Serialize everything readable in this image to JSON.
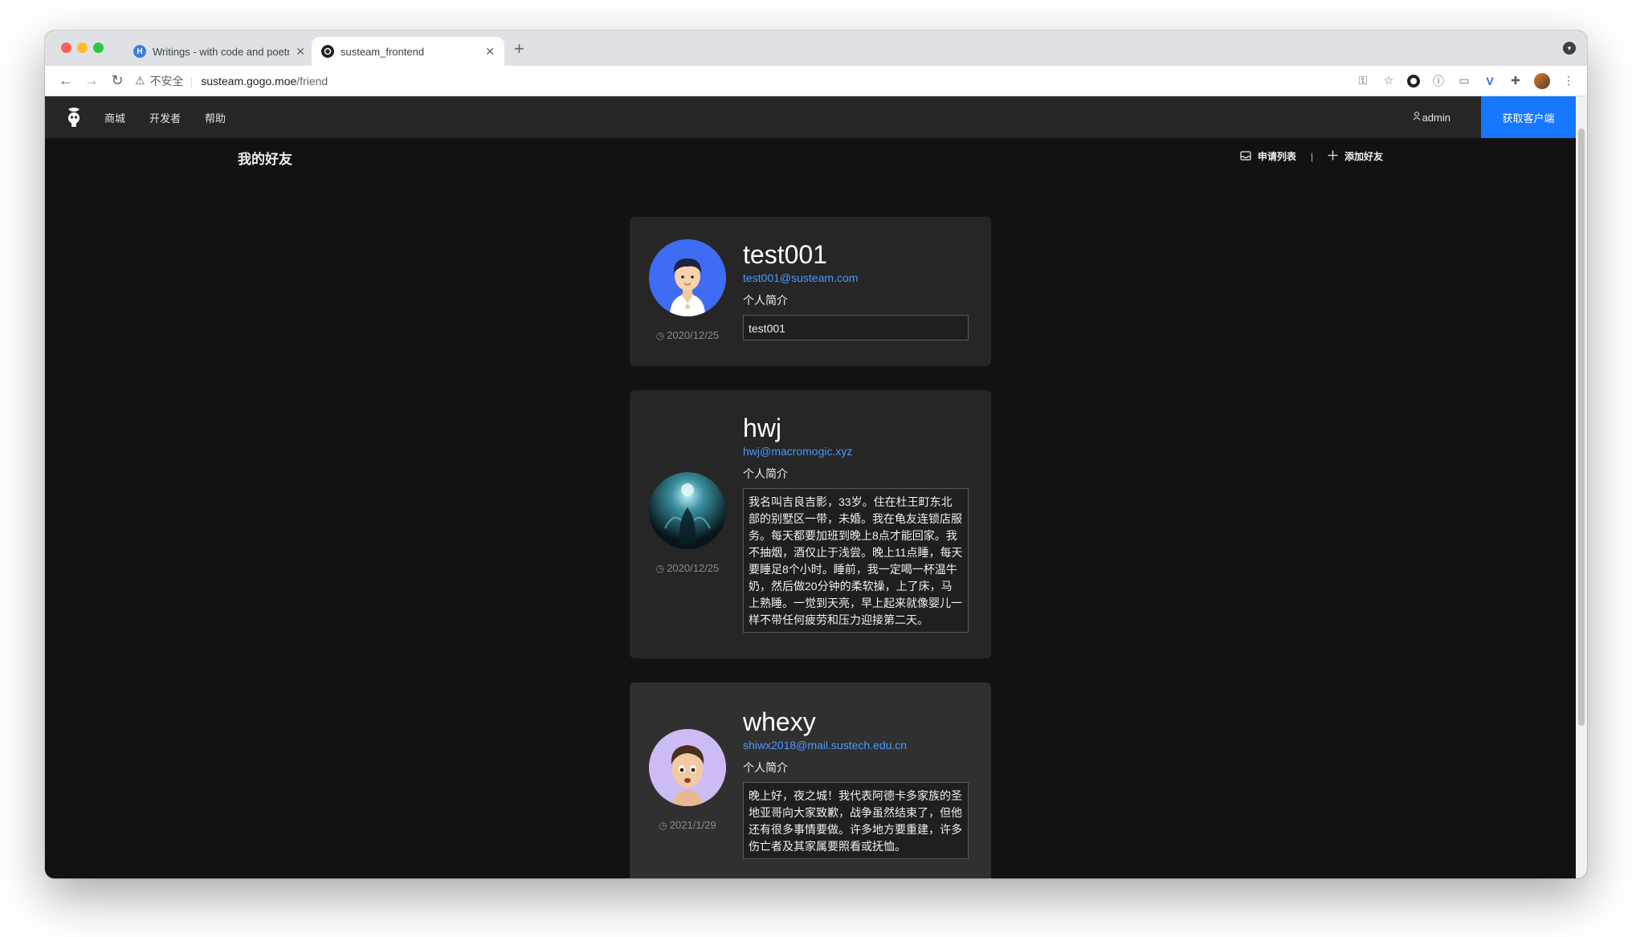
{
  "browser": {
    "tabs": [
      {
        "title": "Writings - with code and poetr",
        "favicon": "H",
        "active": false
      },
      {
        "title": "susteam_frontend",
        "active": true
      }
    ],
    "address": {
      "insecure_label": "不安全",
      "host": "susteam.gogo.moe",
      "path": "/friend"
    }
  },
  "nav": {
    "items": [
      "商城",
      "开发者",
      "帮助"
    ],
    "user": "admin",
    "client_button": "获取客户端"
  },
  "page": {
    "title": "我的好友",
    "actions": {
      "requests": "申请列表",
      "add_friend": "添加好友"
    }
  },
  "friends": [
    {
      "name": "test001",
      "email": "test001@susteam.com",
      "bio_label": "个人简介",
      "bio": "test001",
      "date": "2020/12/25"
    },
    {
      "name": "hwj",
      "email": "hwj@macromogic.xyz",
      "bio_label": "个人简介",
      "bio": "我名叫吉良吉影，33岁。住在杜王町东北部的别墅区一带，未婚。我在龟友连锁店服务。每天都要加班到晚上8点才能回家。我不抽烟，酒仅止于浅尝。晚上11点睡，每天要睡足8个小时。睡前，我一定喝一杯温牛奶，然后做20分钟的柔软操，上了床，马上熟睡。一觉到天亮，早上起来就像婴儿一样不带任何疲劳和压力迎接第二天。",
      "date": "2020/12/25"
    },
    {
      "name": "whexy",
      "email": "shiwx2018@mail.sustech.edu.cn",
      "bio_label": "个人简介",
      "bio": "晚上好，夜之城！我代表阿德卡多家族的圣地亚哥向大家致歉，战争虽然结束了，但他还有很多事情要做。许多地方要重建，许多伤亡者及其家属要照看或抚恤。",
      "date": "2021/1/29"
    }
  ],
  "colors": {
    "accent": "#1677ff",
    "link": "#4a9aff",
    "background": "#121212",
    "card": "#262626",
    "nav": "#262626"
  }
}
